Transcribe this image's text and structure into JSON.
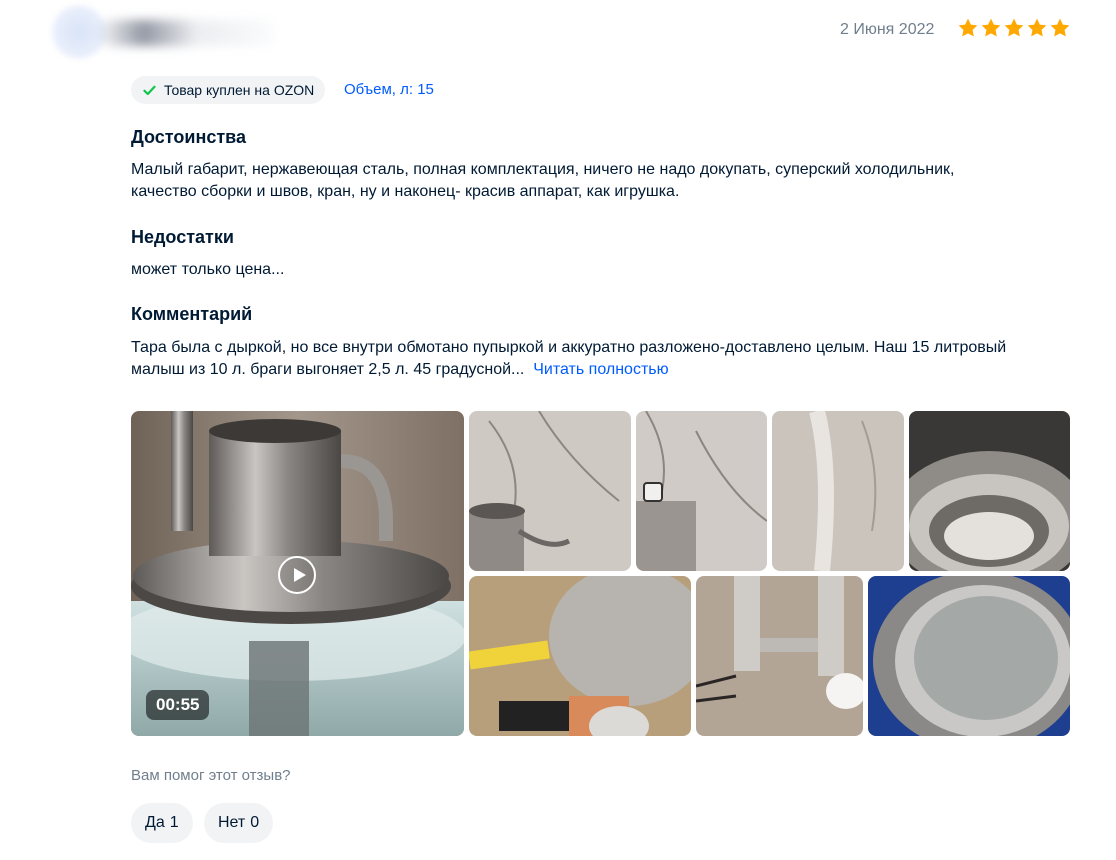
{
  "review": {
    "date": "2 Июня 2022",
    "rating": 5,
    "rating_color": "#ffa800",
    "badge": {
      "icon": "check-icon",
      "label": "Товар куплен на OZON",
      "icon_color": "#10c44c"
    },
    "variant": "Объем, л: 15",
    "pros": {
      "title": "Достоинства",
      "line1": "Малый габарит, нержавеющая сталь, полная комплектация, ничего не надо докупать, суперский холодильник,",
      "line2": "качество сборки и швов, кран, ну и наконец- красив аппарат, как игрушка."
    },
    "cons": {
      "title": "Недостатки",
      "text": "может только цена..."
    },
    "comment": {
      "title": "Комментарий",
      "line1": "Тара была с дыркой, но все внутри обмотано пупыркой и аккуратно разложено-доставлено целым. Наш 15 литровый",
      "line2": "малыш из 10 л. браги выгоняет 2,5 л. 45 градусной...",
      "read_more": "Читать полностью"
    },
    "video": {
      "duration": "00:55",
      "icon": "play-icon"
    },
    "helpful": {
      "question": "Вам помог этот отзыв?",
      "yes_label": "Да",
      "yes_count": "1",
      "no_label": "Нет",
      "no_count": "0"
    }
  },
  "colors": {
    "link": "#005bff",
    "muted": "#707f8d",
    "text": "#001a34",
    "chip_bg": "#f2f3f5"
  }
}
